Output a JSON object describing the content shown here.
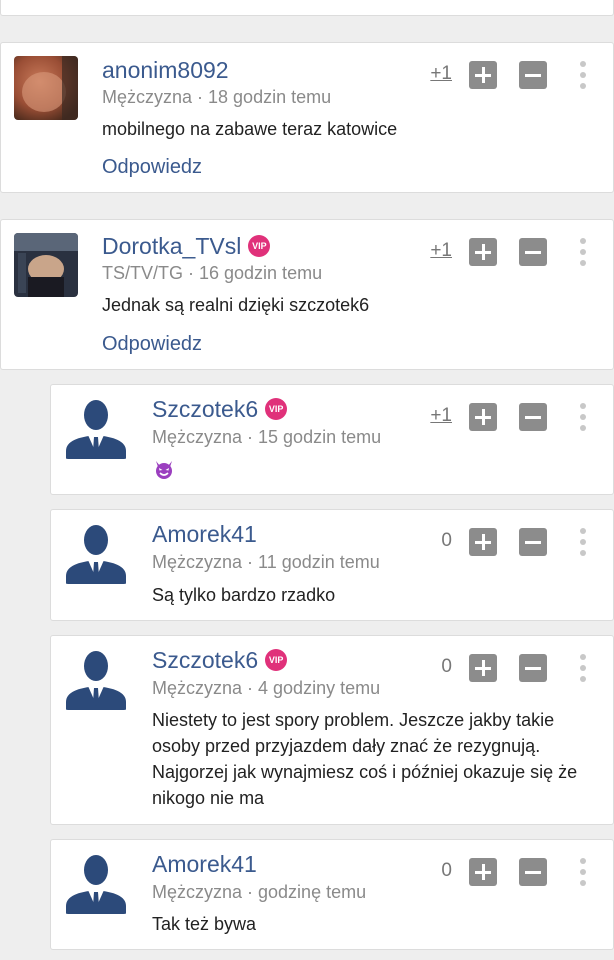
{
  "colors": {
    "link": "#3b5a8e",
    "vip": "#e0317a",
    "vote_button": "#8c8c8c",
    "meta": "#8a8a8a"
  },
  "comments": [
    {
      "username": "anonim8092",
      "vip": false,
      "meta": "Mężczyzna · 18 godzin temu",
      "score": "+1",
      "text": "mobilnego na zabawe teraz katowice",
      "reply": "Odpowiedz",
      "avatar": "photo"
    },
    {
      "username": "Dorotka_TVsl",
      "vip": true,
      "vip_label": "VIP",
      "meta": "TS/TV/TG · 16 godzin temu",
      "score": "+1",
      "text": "Jednak są realni dzięki szczotek6",
      "reply": "Odpowiedz",
      "avatar": "photo"
    },
    {
      "username": "Szczotek6",
      "vip": true,
      "vip_label": "VIP",
      "meta": "Mężczyzna · 15 godzin temu",
      "score": "+1",
      "text_icon": "devil-emoji-icon",
      "avatar": "default-male-icon"
    },
    {
      "username": "Amorek41",
      "vip": false,
      "meta": "Mężczyzna · 11 godzin temu",
      "score": "0",
      "text": "Są tylko bardzo rzadko",
      "avatar": "default-male-icon"
    },
    {
      "username": "Szczotek6",
      "vip": true,
      "vip_label": "VIP",
      "meta": "Mężczyzna · 4 godziny temu",
      "score": "0",
      "text": "Niestety to jest spory problem. Jeszcze jakby takie osoby przed przyjazdem dały znać że rezygnują. Najgorzej jak wynajmiesz coś i później okazuje się że nikogo nie ma",
      "avatar": "default-male-icon"
    },
    {
      "username": "Amorek41",
      "vip": false,
      "meta": "Mężczyzna · godzinę temu",
      "score": "0",
      "text": "Tak też bywa",
      "avatar": "default-male-icon"
    }
  ]
}
